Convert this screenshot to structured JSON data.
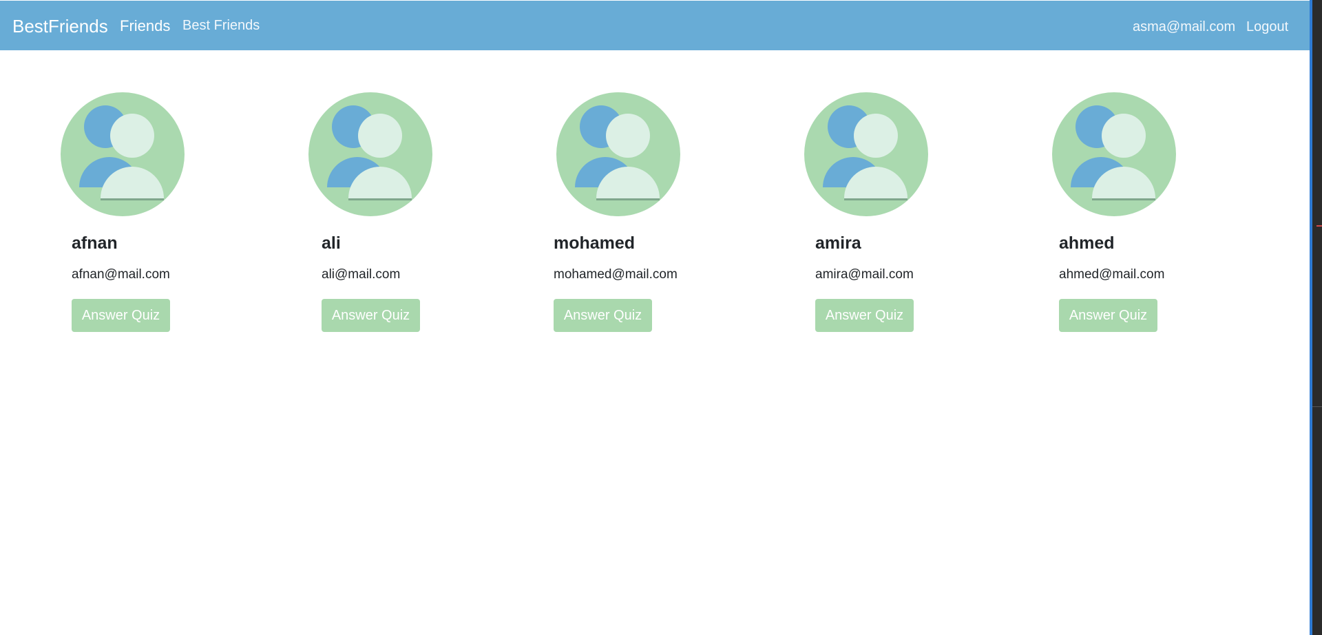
{
  "navbar": {
    "brand": "BestFriends",
    "links": [
      "Friends",
      "Best Friends"
    ],
    "user_email": "asma@mail.com",
    "logout": "Logout"
  },
  "friends": [
    {
      "name": "afnan",
      "email": "afnan@mail.com",
      "button": "Answer Quiz"
    },
    {
      "name": "ali",
      "email": "ali@mail.com",
      "button": "Answer Quiz"
    },
    {
      "name": "mohamed",
      "email": "mohamed@mail.com",
      "button": "Answer Quiz"
    },
    {
      "name": "amira",
      "email": "amira@mail.com",
      "button": "Answer Quiz"
    },
    {
      "name": "ahmed",
      "email": "ahmed@mail.com",
      "button": "Answer Quiz"
    }
  ],
  "colors": {
    "navbar": "#68acd6",
    "button": "#a9d8ad",
    "avatar_bg": "#aad9af",
    "avatar_back_person": "#69acd6",
    "avatar_front_person": "#dcf0e5"
  },
  "icons": {
    "avatar": "user-group-avatar-icon"
  }
}
